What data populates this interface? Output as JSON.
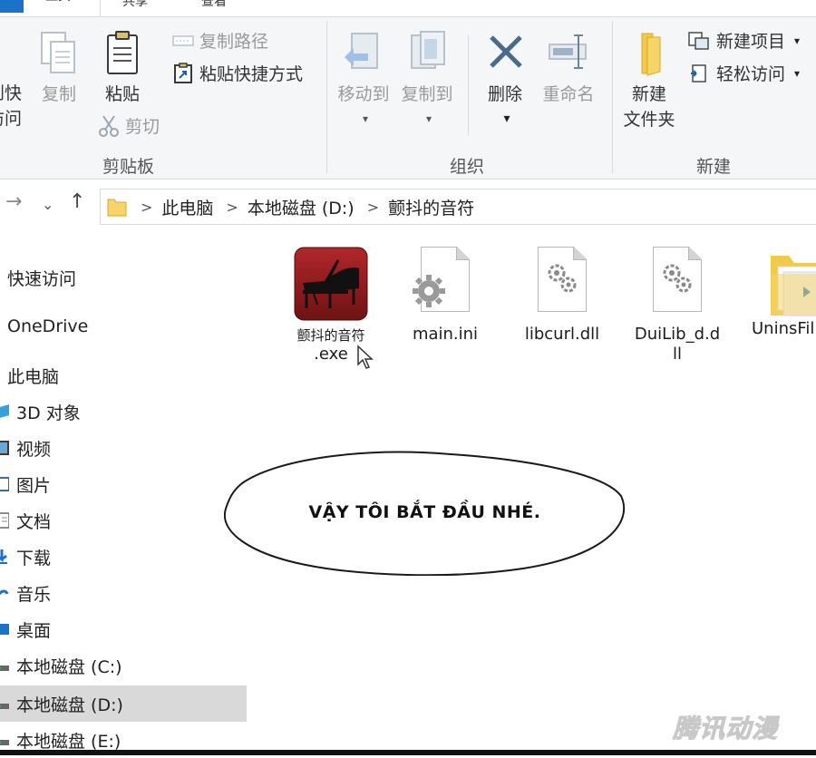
{
  "tabs": {
    "home": "主页",
    "share": "共享",
    "view": "查看"
  },
  "ribbon": {
    "clipboard": {
      "pin_label_1": "到快",
      "pin_label_2": "访问",
      "copy": "复制",
      "paste": "粘贴",
      "copy_path": "复制路径",
      "paste_shortcut": "粘贴快捷方式",
      "cut": "剪切",
      "group_label": "剪贴板"
    },
    "organize": {
      "move_to": "移动到",
      "copy_to": "复制到",
      "delete": "删除",
      "rename": "重命名",
      "group_label": "组织"
    },
    "new": {
      "new_folder_1": "新建",
      "new_folder_2": "文件夹",
      "new_item": "新建项目",
      "easy_access": "轻松访问",
      "group_label": "新建"
    }
  },
  "address": {
    "path": [
      "此电脑",
      "本地磁盘 (D:)",
      "颤抖的音符"
    ]
  },
  "nav_pane": {
    "items": [
      {
        "label": "快速访问",
        "icon": "star-icon"
      },
      {
        "label": "OneDrive",
        "icon": "cloud-icon"
      },
      {
        "label": "此电脑",
        "icon": "computer-icon"
      },
      {
        "label": "3D 对象",
        "icon": "cube-icon"
      },
      {
        "label": "视频",
        "icon": "film-icon"
      },
      {
        "label": "图片",
        "icon": "picture-icon"
      },
      {
        "label": "文档",
        "icon": "document-icon"
      },
      {
        "label": "下载",
        "icon": "download-icon"
      },
      {
        "label": "音乐",
        "icon": "music-icon"
      },
      {
        "label": "桌面",
        "icon": "desktop-icon"
      },
      {
        "label": "本地磁盘 (C:)",
        "icon": "drive-icon"
      },
      {
        "label": "本地磁盘 (D:)",
        "icon": "drive-icon",
        "selected": true
      },
      {
        "label": "本地磁盘 (E:)",
        "icon": "drive-icon"
      }
    ]
  },
  "files": [
    {
      "name_line1": "颤抖的音符",
      "name_line2": ".exe",
      "icon": "piano-app-icon"
    },
    {
      "name": "main.ini",
      "icon": "settings-file-icon"
    },
    {
      "name": "libcurl.dll",
      "icon": "dll-file-icon"
    },
    {
      "name_line1": "DuiLib_d.d",
      "name_line2": "ll",
      "icon": "dll-file-icon"
    },
    {
      "name": "UninsFil",
      "icon": "folder-icon"
    }
  ],
  "bubble": {
    "text": "VẬY TÔI BẮT ĐẦU NHÉ."
  },
  "watermark": "腾讯动漫"
}
